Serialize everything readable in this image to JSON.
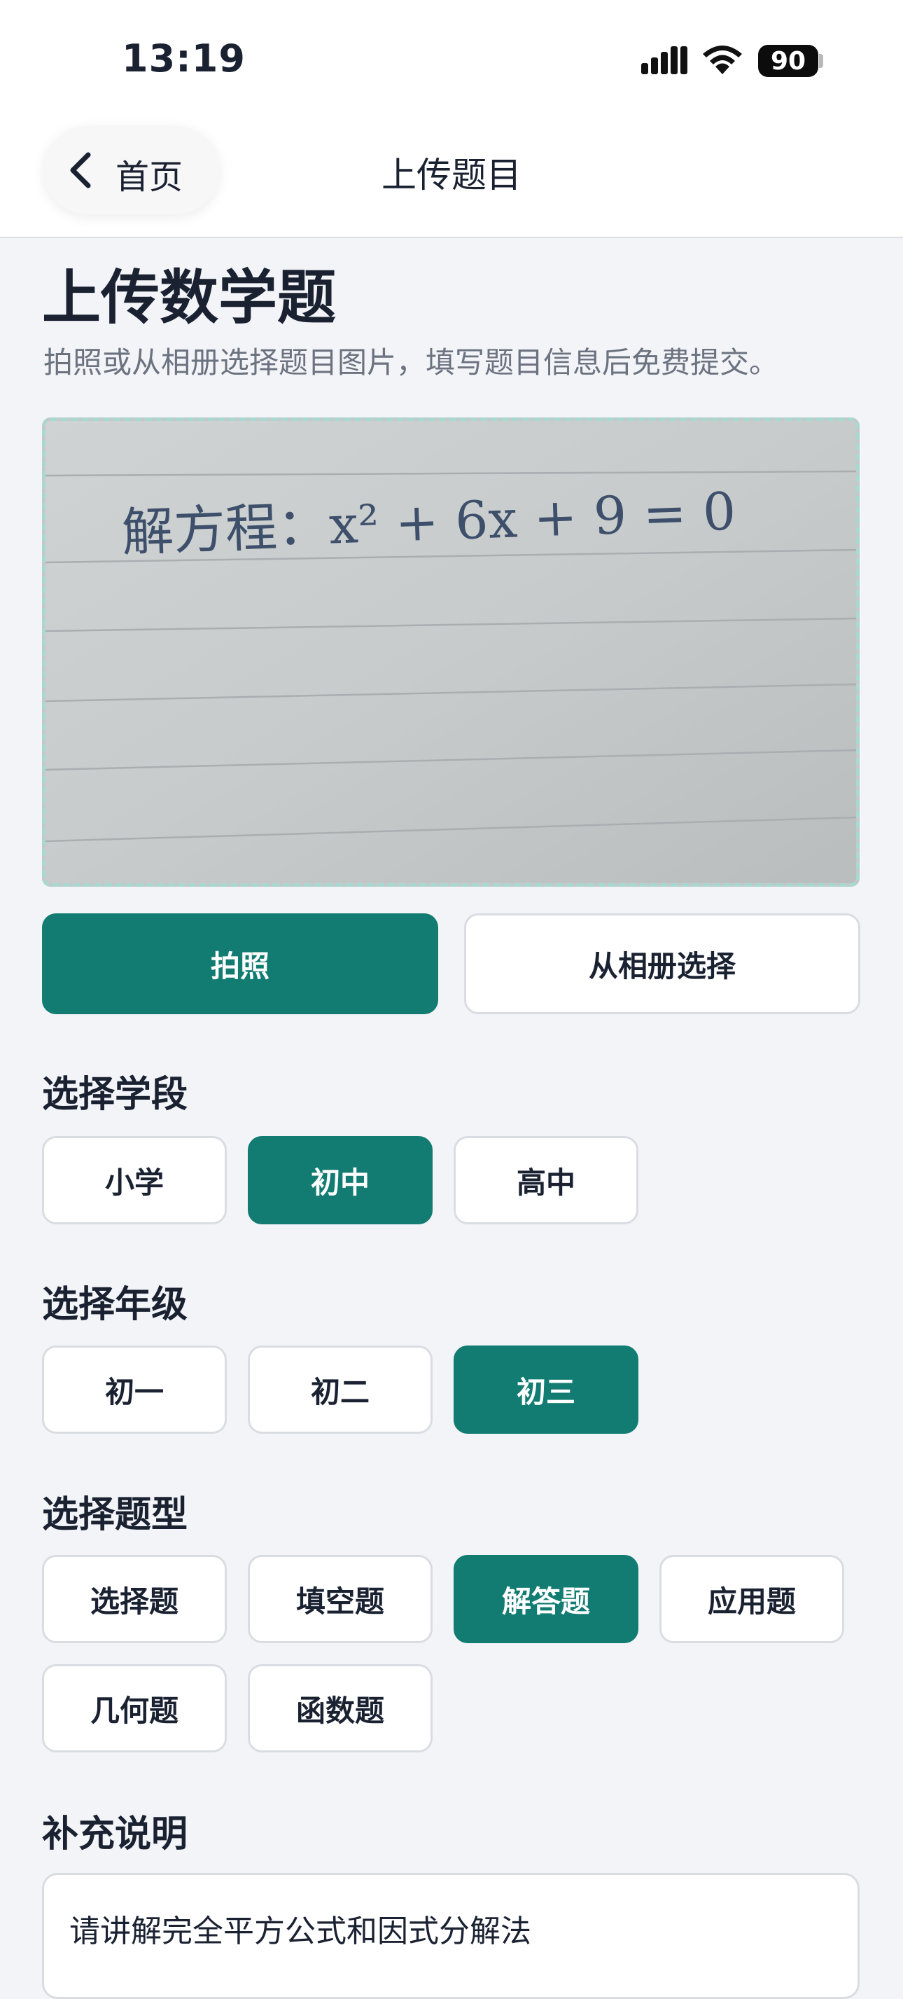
{
  "status_bar": {
    "time": "13:19",
    "battery": "90",
    "icons": [
      "signal-icon",
      "wifi-icon",
      "battery-icon"
    ]
  },
  "nav": {
    "back_label": "首页",
    "title": "上传题目"
  },
  "header": {
    "title": "上传数学题",
    "subtitle": "拍照或从相册选择题目图片，填写题目信息后免费提交。"
  },
  "photo": {
    "handwritten_text": "解方程：x² + 6x + 9 = 0"
  },
  "actions": {
    "camera_label": "拍照",
    "album_label": "从相册选择"
  },
  "stage": {
    "label": "选择学段",
    "options": [
      "小学",
      "初中",
      "高中"
    ],
    "selected": "初中"
  },
  "grade": {
    "label": "选择年级",
    "options": [
      "初一",
      "初二",
      "初三"
    ],
    "selected": "初三"
  },
  "type": {
    "label": "选择题型",
    "options": [
      "选择题",
      "填空题",
      "解答题",
      "应用题",
      "几何题",
      "函数题"
    ],
    "selected": "解答题"
  },
  "notes": {
    "label": "补充说明",
    "value": "请讲解完全平方公式和因式分解法"
  },
  "colors": {
    "accent": "#127c72",
    "background": "#f3f4f7",
    "text": "#1a2232",
    "muted": "#6b7280",
    "dashed_border": "#a9d8d0"
  }
}
